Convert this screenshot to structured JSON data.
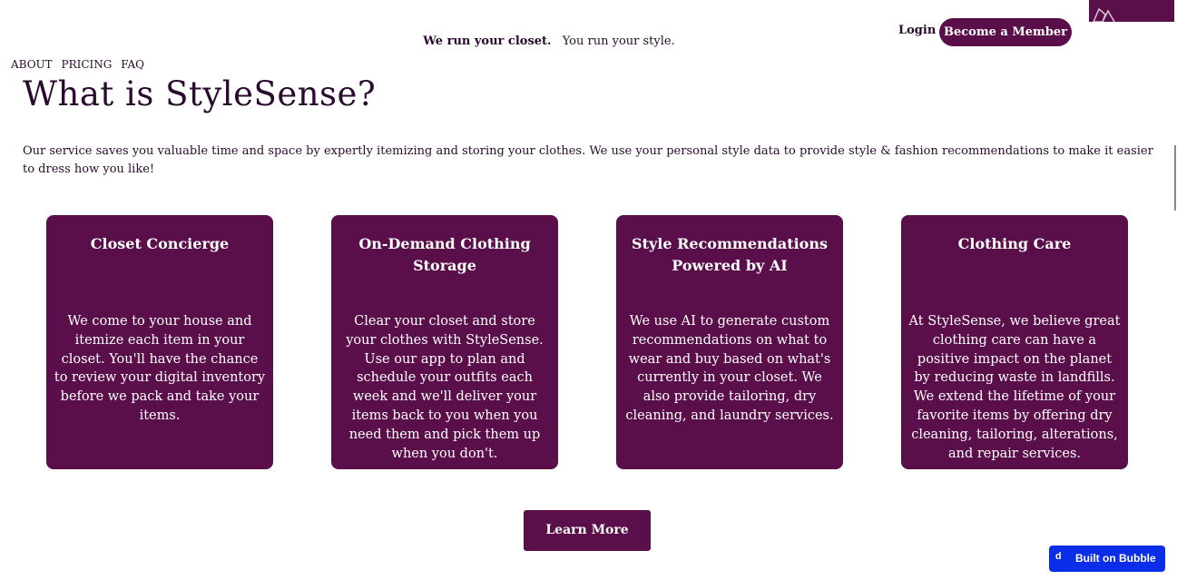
{
  "header": {
    "tagline_strong": "We run your closet.",
    "tagline_rest": "You run your style.",
    "login_label": "Login",
    "member_button_label": "Become a Member"
  },
  "nav": {
    "items": [
      {
        "label": "ABOUT"
      },
      {
        "label": "PRICING"
      },
      {
        "label": "FAQ"
      }
    ]
  },
  "main": {
    "title": "What is StyleSense?",
    "intro": "Our service saves you valuable time and space by expertly itemizing and storing your clothes. We use your personal style data to provide style & fashion recommendations to make it easier to dress how you like!",
    "cards": [
      {
        "title": "Closet Concierge",
        "body": "We come to your house and itemize each item in your closet. You'll have the chance to review your digital inventory before we pack and take your items."
      },
      {
        "title": "On-Demand Clothing Storage",
        "body": "Clear your closet and store your clothes with StyleSense. Use our app to plan and schedule your outfits each week and we'll deliver your items back to you when you need them and pick them up when you don't."
      },
      {
        "title": "Style Recommendations Powered by AI",
        "body": "We use AI to generate custom recommendations on what to wear and buy based on what's currently in your closet. We also provide tailoring, dry cleaning, and laundry services."
      },
      {
        "title": "Clothing Care",
        "body": "At StyleSense, we believe great clothing care can have a positive impact on the planet by reducing waste in landfills. We extend the lifetime of your favorite items by offering dry cleaning, tailoring, alterations, and repair services."
      }
    ],
    "learn_more_label": "Learn More"
  },
  "badge": {
    "icon": "bubble-logo-icon",
    "label": "Built on Bubble"
  },
  "colors": {
    "brand": "#5a0e4a",
    "text": "#2a0a2e",
    "badge": "#0a2ee8"
  }
}
